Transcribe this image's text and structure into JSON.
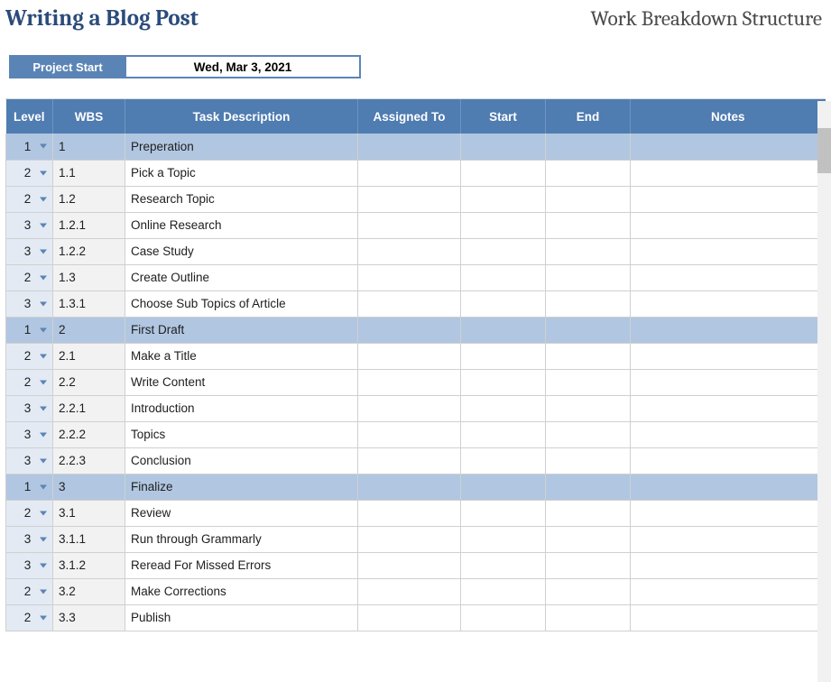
{
  "header": {
    "title": "Writing a Blog Post",
    "subtitle": "Work Breakdown Structure"
  },
  "project_start": {
    "label": "Project Start",
    "value": "Wed, Mar 3, 2021"
  },
  "columns": {
    "level": "Level",
    "wbs": "WBS",
    "desc": "Task Description",
    "assigned": "Assigned To",
    "start": "Start",
    "end": "End",
    "notes": "Notes"
  },
  "rows": [
    {
      "level": "1",
      "wbs": "1",
      "desc": "Preperation",
      "assigned": "",
      "start": "",
      "end": "",
      "notes": ""
    },
    {
      "level": "2",
      "wbs": "1.1",
      "desc": "Pick a Topic",
      "assigned": "",
      "start": "",
      "end": "",
      "notes": ""
    },
    {
      "level": "2",
      "wbs": "1.2",
      "desc": "Research Topic",
      "assigned": "",
      "start": "",
      "end": "",
      "notes": ""
    },
    {
      "level": "3",
      "wbs": "1.2.1",
      "desc": "Online Research",
      "assigned": "",
      "start": "",
      "end": "",
      "notes": ""
    },
    {
      "level": "3",
      "wbs": "1.2.2",
      "desc": "Case Study",
      "assigned": "",
      "start": "",
      "end": "",
      "notes": ""
    },
    {
      "level": "2",
      "wbs": "1.3",
      "desc": "Create Outline",
      "assigned": "",
      "start": "",
      "end": "",
      "notes": ""
    },
    {
      "level": "3",
      "wbs": "1.3.1",
      "desc": "Choose Sub Topics of Article",
      "assigned": "",
      "start": "",
      "end": "",
      "notes": ""
    },
    {
      "level": "1",
      "wbs": "2",
      "desc": "First Draft",
      "assigned": "",
      "start": "",
      "end": "",
      "notes": ""
    },
    {
      "level": "2",
      "wbs": "2.1",
      "desc": "Make a Title",
      "assigned": "",
      "start": "",
      "end": "",
      "notes": ""
    },
    {
      "level": "2",
      "wbs": "2.2",
      "desc": "Write Content",
      "assigned": "",
      "start": "",
      "end": "",
      "notes": ""
    },
    {
      "level": "3",
      "wbs": "2.2.1",
      "desc": "Introduction",
      "assigned": "",
      "start": "",
      "end": "",
      "notes": ""
    },
    {
      "level": "3",
      "wbs": "2.2.2",
      "desc": "Topics",
      "assigned": "",
      "start": "",
      "end": "",
      "notes": ""
    },
    {
      "level": "3",
      "wbs": "2.2.3",
      "desc": "Conclusion",
      "assigned": "",
      "start": "",
      "end": "",
      "notes": ""
    },
    {
      "level": "1",
      "wbs": "3",
      "desc": "Finalize",
      "assigned": "",
      "start": "",
      "end": "",
      "notes": ""
    },
    {
      "level": "2",
      "wbs": "3.1",
      "desc": "Review",
      "assigned": "",
      "start": "",
      "end": "",
      "notes": ""
    },
    {
      "level": "3",
      "wbs": "3.1.1",
      "desc": "Run through Grammarly",
      "assigned": "",
      "start": "",
      "end": "",
      "notes": ""
    },
    {
      "level": "3",
      "wbs": "3.1.2",
      "desc": "Reread For Missed Errors",
      "assigned": "",
      "start": "",
      "end": "",
      "notes": ""
    },
    {
      "level": "2",
      "wbs": "3.2",
      "desc": "Make Corrections",
      "assigned": "",
      "start": "",
      "end": "",
      "notes": ""
    },
    {
      "level": "2",
      "wbs": "3.3",
      "desc": "Publish",
      "assigned": "",
      "start": "",
      "end": "",
      "notes": ""
    }
  ]
}
